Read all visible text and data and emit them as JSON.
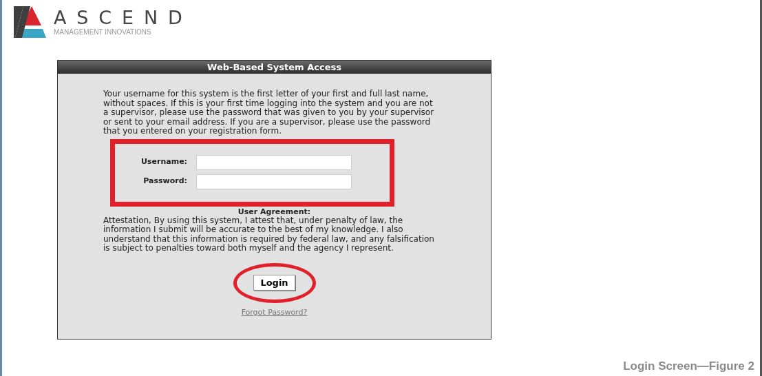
{
  "logo": {
    "name": "ASCEND",
    "tagline": "MANAGEMENT INNOVATIONS"
  },
  "panel": {
    "title": "Web-Based System Access",
    "intro": "Your username for this system is the first letter of your first and full last name, without spaces. If this is your first time logging into the system and you are not a supervisor, please use the password that was given to you by your supervisor or sent to your email address. If you are a supervisor, please use the password that you entered on your registration form.",
    "fields": [
      {
        "label": "Username:"
      },
      {
        "label": "Password:"
      }
    ],
    "agreement_heading": "User Agreement:",
    "agreement_text": "Attestation, By using this system, I attest that, under penalty of law, the information I submit will be accurate to the best of my knowledge. I also understand that this information is required by federal law, and any falsification is subject to penalties toward both myself and the agency I represent.",
    "login_button": "Login",
    "forgot_link": "Forgot Password?"
  },
  "caption": "Login Screen—Figure 2"
}
